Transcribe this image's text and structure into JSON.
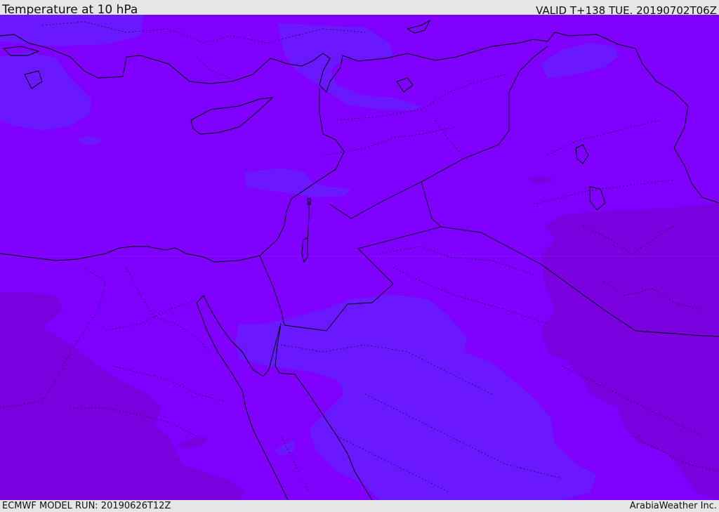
{
  "header": {
    "title": "Temperature at 10 hPa",
    "valid_time": "VALID T+138 TUE. 20190702T06Z"
  },
  "footer": {
    "model_run": "ECMWF MODEL RUN: 20190626T12Z",
    "provider": "ArabiaWeather Inc."
  },
  "colors": {
    "field_base": "#7f00ff",
    "field_cooler": "#6a18ff",
    "field_warmer": "#7a00e0",
    "coastline": "#000000",
    "borders": "#1a0040"
  }
}
